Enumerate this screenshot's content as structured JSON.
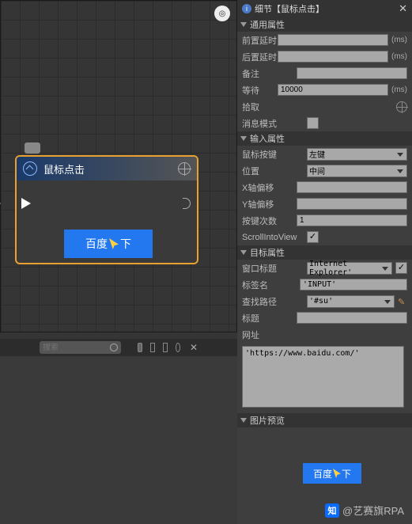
{
  "panel_title": "细节【鼠标点击】",
  "node": {
    "title": "鼠标点击",
    "button_part1": "百度",
    "button_part2": "下"
  },
  "toolbar": {
    "search_placeholder": "搜索"
  },
  "sections": {
    "general": "通用属性",
    "input": "输入属性",
    "target": "目标属性",
    "preview": "图片预览"
  },
  "general": {
    "pre_delay_label": "前置延时",
    "pre_delay": "",
    "ms1": "(ms)",
    "post_delay_label": "后置延时",
    "post_delay": "",
    "ms2": "(ms)",
    "note_label": "备注",
    "note": "",
    "wait_label": "等待",
    "wait": "10000",
    "ms3": "(ms)",
    "pick_label": "拾取",
    "msg_label": "消息模式"
  },
  "input": {
    "mouse_btn_label": "鼠标按键",
    "mouse_btn": "左键",
    "pos_label": "位置",
    "pos": "中间",
    "xoff_label": "X轴偏移",
    "xoff": "",
    "yoff_label": "Y轴偏移",
    "yoff": "",
    "times_label": "按键次数",
    "times": "1",
    "scroll_label": "ScrollIntoView"
  },
  "target": {
    "wintitle_label": "窗口标题",
    "wintitle": "Internet Explorer'",
    "tagname_label": "标签名",
    "tagname": "'INPUT'",
    "path_label": "查找路径",
    "path": "'#su'",
    "title_label": "标题",
    "title": "",
    "url_label": "网址",
    "url": "'https://www.baidu.com/'"
  },
  "preview": {
    "button_part1": "百度",
    "button_part2": "下"
  },
  "watermark": {
    "zhi": "知",
    "text": "@艺赛旗RPA"
  }
}
